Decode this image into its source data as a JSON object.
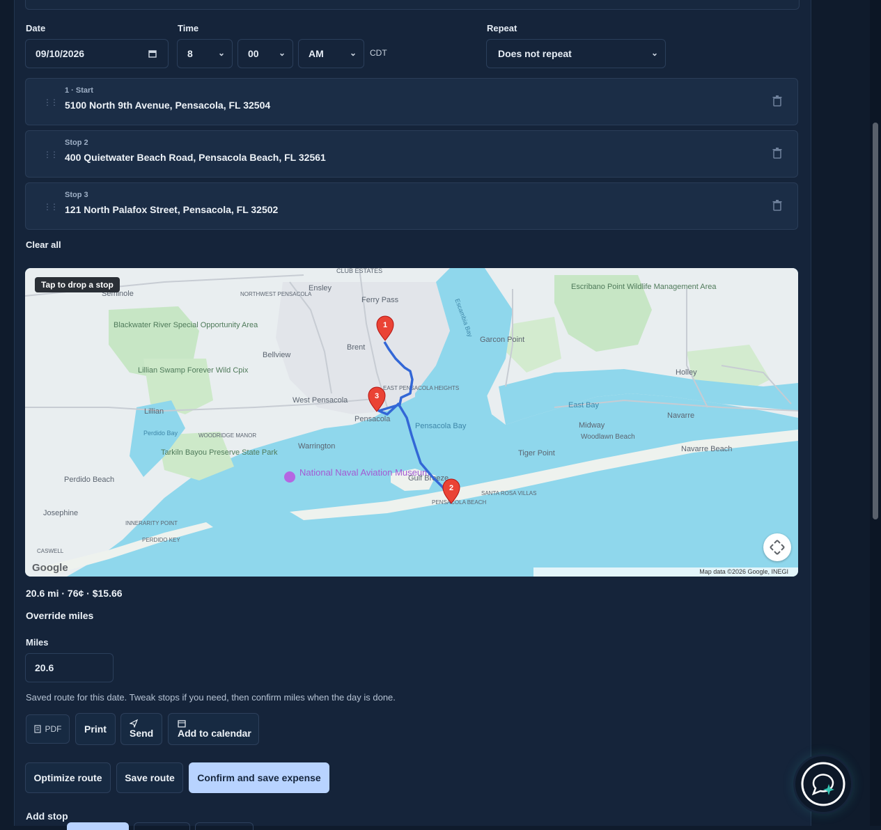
{
  "schedule": {
    "date_label": "Date",
    "date_value": "09/10/2026",
    "time_label": "Time",
    "hour": "8",
    "minute": "00",
    "ampm": "AM",
    "timezone": "CDT",
    "repeat_label": "Repeat",
    "repeat_value": "Does not repeat"
  },
  "stops": [
    {
      "label": "1 · Start",
      "address": "5100 North 9th Avenue, Pensacola, FL 32504"
    },
    {
      "label": "Stop 2",
      "address": "400 Quietwater Beach Road, Pensacola Beach, FL 32561"
    },
    {
      "label": "Stop 3",
      "address": "121 North Palafox Street, Pensacola, FL 32502"
    }
  ],
  "clear_all": "Clear all",
  "map": {
    "tap_hint": "Tap to drop a stop",
    "logo": "Google",
    "attribution": "Map data ©2026 Google, INEGI",
    "marker_1": "1",
    "marker_2": "2",
    "marker_3": "3",
    "places": {
      "club_estates": "CLUB ESTATES",
      "ensley": "Ensley",
      "northwest_pensacola": "NORTHWEST PENSACOLA",
      "ferry_pass": "Ferry Pass",
      "escambia_bay": "Escambia Bay",
      "escribano": "Escribano Point Wildlife Management Area",
      "blackwater": "Blackwater River Special Opportunity Area",
      "brent": "Brent",
      "bellview": "Bellview",
      "garcon_point": "Garcon Point",
      "lillian_swamp": "Lillian Swamp Forever Wild Cpix",
      "holley": "Holley",
      "east_pensacola_heights": "EAST PENSACOLA HEIGHTS",
      "west_pensacola": "West Pensacola",
      "east_bay": "East Bay",
      "lillian": "Lillian",
      "pensacola": "Pensacola",
      "pensacola_bay": "Pensacola Bay",
      "navarre": "Navarre",
      "midway": "Midway",
      "woodridge_manor": "WOODRIDGE MANOR",
      "woodlawn_beach": "Woodlawn Beach",
      "warrington": "Warrington",
      "tarkiln": "Tarkiln Bayou Preserve State Park",
      "perdido_bay": "Perdido Bay",
      "tiger_point": "Tiger Point",
      "navarre_beach": "Navarre Beach",
      "naval_museum": "National Naval Aviation Museum",
      "gulf_breeze": "Gulf Breeze",
      "perdido_beach": "Perdido Beach",
      "santa_rosa_villas": "SANTA ROSA VILLAS",
      "pensacola_beach": "PENSACOLA BEACH",
      "josephine": "Josephine",
      "innerarity_point": "INNERARITY POINT",
      "perdido_key": "PERDIDO KEY",
      "caswell": "CASWELL",
      "seminole": "Seminole"
    }
  },
  "summary": "20.6 mi · 76¢ · $15.66",
  "override_label": "Override miles",
  "miles_label": "Miles",
  "miles_value": "20.6",
  "saved_note": "Saved route for this date. Tweak stops if you need, then confirm miles when the day is done.",
  "export": {
    "pdf": "PDF",
    "print": "Print",
    "send": "Send",
    "calendar": "Add to calendar"
  },
  "actions": {
    "optimize": "Optimize route",
    "save": "Save route",
    "confirm": "Confirm and save expense"
  },
  "add_stop_label": "Add stop"
}
